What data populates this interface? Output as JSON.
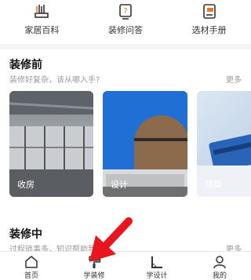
{
  "top_categories": [
    {
      "label": "家居百科",
      "icon": "furniture-icon"
    },
    {
      "label": "装修问答",
      "icon": "qa-icon"
    },
    {
      "label": "选材手册",
      "icon": "manual-icon"
    }
  ],
  "section_before": {
    "title": "装修前",
    "subtitle": "装修好复杂，该从哪入手?",
    "more": "更多",
    "cards": [
      {
        "label": "收房"
      },
      {
        "label": "设计"
      },
      {
        "label": "预算"
      }
    ]
  },
  "section_during": {
    "title": "装修中",
    "subtitle": "过程琐事多，知识帮助我",
    "more": "更多"
  },
  "tabbar": [
    {
      "label": "首页",
      "icon": "home-icon"
    },
    {
      "label": "学装修",
      "icon": "paint-roller-icon"
    },
    {
      "label": "学设计",
      "icon": "ruler-icon"
    },
    {
      "label": "我的",
      "icon": "user-icon"
    }
  ],
  "colors": {
    "accent_arrow": "#e8161c",
    "card_blue": "#1f73d9"
  }
}
